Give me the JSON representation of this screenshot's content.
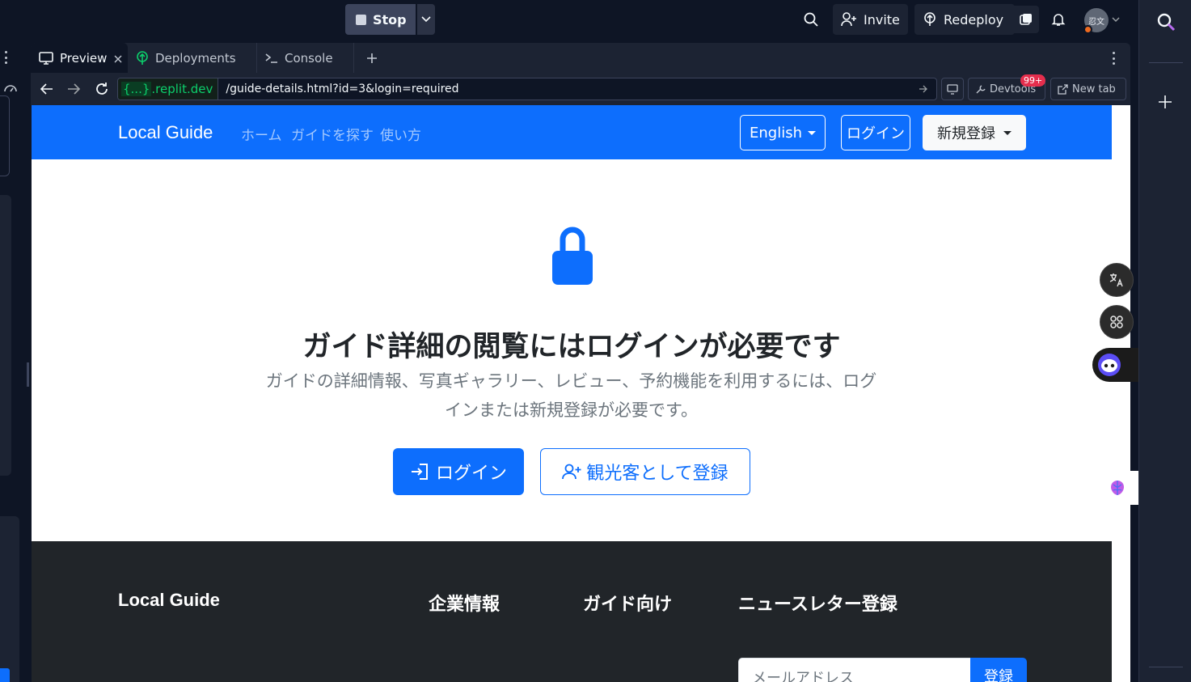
{
  "topbar": {
    "stop_label": "Stop",
    "invite_label": "Invite",
    "redeploy_label": "Redeploy",
    "avatar_text": "忍文"
  },
  "pane": {
    "tabs": [
      {
        "label": "Preview",
        "icon": "monitor-icon",
        "active": true
      },
      {
        "label": "Deployments",
        "icon": "deploy-icon",
        "active": false
      },
      {
        "label": "Console",
        "icon": "terminal-icon",
        "active": false
      }
    ]
  },
  "urlbar": {
    "domain_prefix": "{...}",
    "domain_suffix": ".replit.dev",
    "path": "/guide-details.html?id=3&login=required",
    "devtools_label": "Devtools",
    "devtools_badge": "99+",
    "new_tab_label": "New tab"
  },
  "site": {
    "brand": "Local Guide",
    "nav_links": [
      "ホーム",
      "ガイドを探す",
      "使い方"
    ],
    "language_label": "English",
    "login_label": "ログイン",
    "signup_label": "新規登録",
    "heading": "ガイド詳細の閲覧にはログインが必要です",
    "lead": "ガイドの詳細情報、写真ギャラリー、レビュー、予約機能を利用するには、ログインまたは新規登録が必要です。",
    "login_button": "ログイン",
    "register_button": "観光客として登録",
    "footer": {
      "brand": "Local Guide",
      "col_company": "企業情報",
      "col_guides": "ガイド向け",
      "col_newsletter": "ニュースレター登録",
      "email_placeholder": "メールアドレス",
      "submit_label": "登録"
    }
  },
  "colors": {
    "primary": "#0d6efd",
    "footer_bg": "#212529",
    "ide_bg": "#0e1525"
  }
}
